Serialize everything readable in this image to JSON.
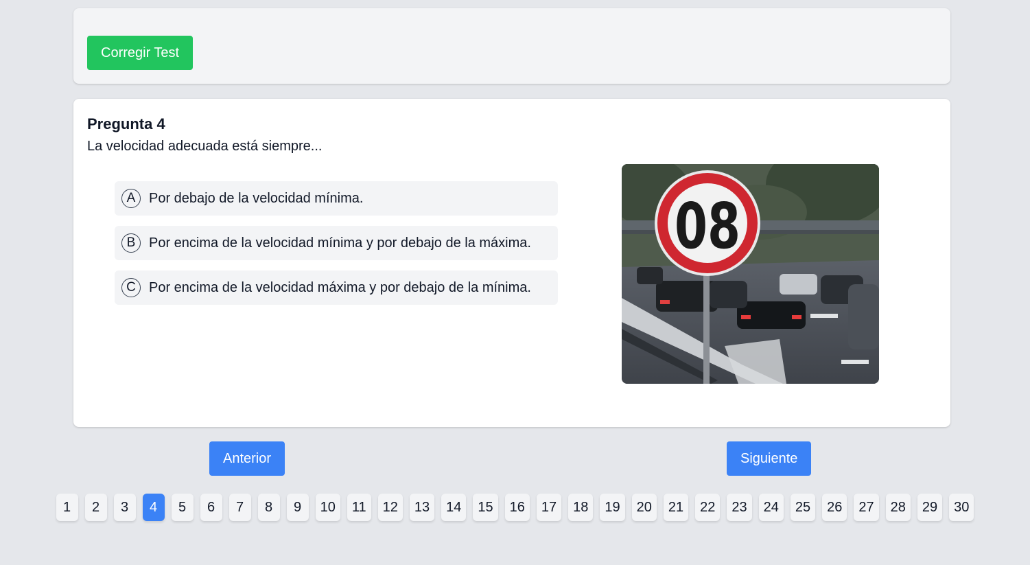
{
  "toolbar": {
    "correct_label": "Corregir Test"
  },
  "question": {
    "title": "Pregunta 4",
    "text": "La velocidad adecuada está siempre...",
    "options": [
      {
        "letter": "A",
        "text": "Por debajo de la velocidad mínima."
      },
      {
        "letter": "B",
        "text": "Por encima de la velocidad mínima y por debajo de la máxima."
      },
      {
        "letter": "C",
        "text": "Por encima de la velocidad máxima y por debajo de la mínima."
      }
    ],
    "image": {
      "sign_text": "08"
    }
  },
  "navigation": {
    "prev_label": "Anterior",
    "next_label": "Siguiente"
  },
  "pagination": {
    "pages": [
      "1",
      "2",
      "3",
      "4",
      "5",
      "6",
      "7",
      "8",
      "9",
      "10",
      "11",
      "12",
      "13",
      "14",
      "15",
      "16",
      "17",
      "18",
      "19",
      "20",
      "21",
      "22",
      "23",
      "24",
      "25",
      "26",
      "27",
      "28",
      "29",
      "30"
    ],
    "current": "4"
  },
  "colors": {
    "green": "#22c55e",
    "blue": "#3b82f6",
    "background": "#e5e7eb"
  }
}
